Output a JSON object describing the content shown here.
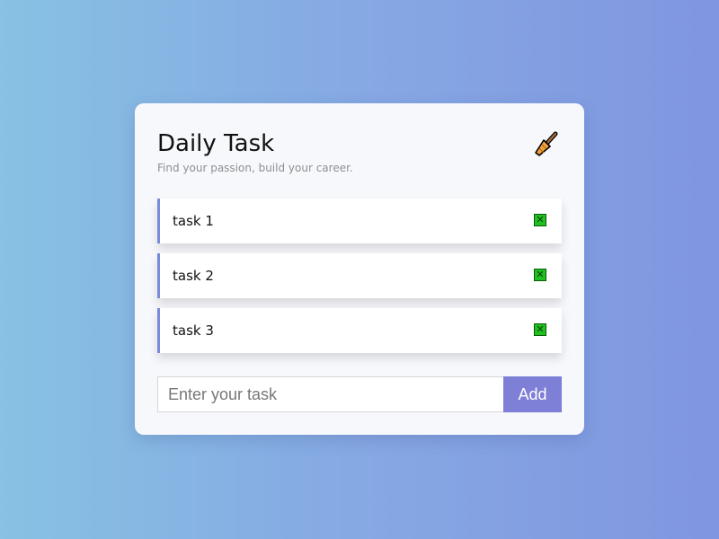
{
  "app": {
    "title": "Daily Task",
    "subtitle": "Find your passion, build your career."
  },
  "tasks": [
    {
      "label": "task 1",
      "delete_icon": "cross-mark-icon"
    },
    {
      "label": "task 2",
      "delete_icon": "cross-mark-icon"
    },
    {
      "label": "task 3",
      "delete_icon": "cross-mark-icon"
    }
  ],
  "input": {
    "placeholder": "Enter your task",
    "value": ""
  },
  "add_button": {
    "label": "Add"
  },
  "icons": {
    "clear": "broom-icon",
    "delete_glyph": "✕"
  },
  "colors": {
    "accent": "#7e7fd6",
    "task_border": "#7c8ad8",
    "delete_green": "#21c021",
    "background_start": "#87c1e3",
    "background_end": "#8096e0"
  }
}
